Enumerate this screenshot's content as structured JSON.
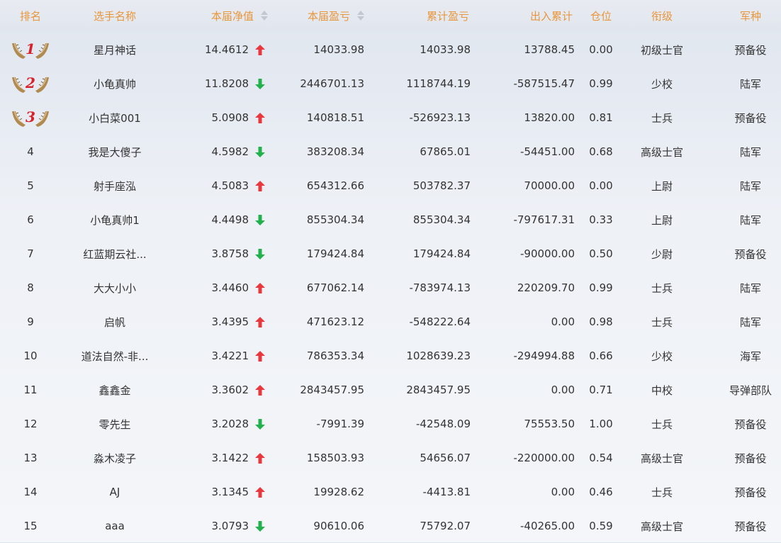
{
  "header": {
    "rank": "排名",
    "name": "选手名称",
    "nav": "本届净值",
    "pnl": "本届盈亏",
    "cumulative": "累计盈亏",
    "flow": "出入累计",
    "position": "仓位",
    "title": "衔级",
    "arm": "军种"
  },
  "colors": {
    "header_text": "#e8963c",
    "up_arrow": "#e8383d",
    "down_arrow": "#23b14d",
    "medal_number": "#d8222a",
    "wing": "#b08a50"
  },
  "rows": [
    {
      "rank": "1",
      "medal": true,
      "name": "星月神话",
      "nav": "14.4612",
      "trend": "up",
      "pnl": "14033.98",
      "cumulative": "14033.98",
      "flow": "13788.45",
      "position": "0.00",
      "title": "初级士官",
      "arm": "预备役"
    },
    {
      "rank": "2",
      "medal": true,
      "name": "小龟真帅",
      "nav": "11.8208",
      "trend": "down",
      "pnl": "2446701.13",
      "cumulative": "1118744.19",
      "flow": "-587515.47",
      "position": "0.99",
      "title": "少校",
      "arm": "陆军"
    },
    {
      "rank": "3",
      "medal": true,
      "name": "小白菜001",
      "nav": "5.0908",
      "trend": "up",
      "pnl": "140818.51",
      "cumulative": "-526923.13",
      "flow": "13820.00",
      "position": "0.81",
      "title": "士兵",
      "arm": "预备役"
    },
    {
      "rank": "4",
      "medal": false,
      "name": "我是大傻子",
      "nav": "4.5982",
      "trend": "down",
      "pnl": "383208.34",
      "cumulative": "67865.01",
      "flow": "-54451.00",
      "position": "0.68",
      "title": "高级士官",
      "arm": "陆军"
    },
    {
      "rank": "5",
      "medal": false,
      "name": "射手座泓",
      "nav": "4.5083",
      "trend": "up",
      "pnl": "654312.66",
      "cumulative": "503782.37",
      "flow": "70000.00",
      "position": "0.00",
      "title": "上尉",
      "arm": "陆军"
    },
    {
      "rank": "6",
      "medal": false,
      "name": "小龟真帅1",
      "nav": "4.4498",
      "trend": "down",
      "pnl": "855304.34",
      "cumulative": "855304.34",
      "flow": "-797617.31",
      "position": "0.33",
      "title": "上尉",
      "arm": "陆军"
    },
    {
      "rank": "7",
      "medal": false,
      "name": "红蓝期云社...",
      "nav": "3.8758",
      "trend": "down",
      "pnl": "179424.84",
      "cumulative": "179424.84",
      "flow": "-90000.00",
      "position": "0.50",
      "title": "少尉",
      "arm": "预备役"
    },
    {
      "rank": "8",
      "medal": false,
      "name": "大大小小",
      "nav": "3.4460",
      "trend": "up",
      "pnl": "677062.14",
      "cumulative": "-783974.13",
      "flow": "220209.70",
      "position": "0.99",
      "title": "士兵",
      "arm": "陆军"
    },
    {
      "rank": "9",
      "medal": false,
      "name": "启帆",
      "nav": "3.4395",
      "trend": "up",
      "pnl": "471623.12",
      "cumulative": "-548222.64",
      "flow": "0.00",
      "position": "0.98",
      "title": "士兵",
      "arm": "陆军"
    },
    {
      "rank": "10",
      "medal": false,
      "name": "道法自然-非...",
      "nav": "3.4221",
      "trend": "up",
      "pnl": "786353.34",
      "cumulative": "1028639.23",
      "flow": "-294994.88",
      "position": "0.66",
      "title": "少校",
      "arm": "海军"
    },
    {
      "rank": "11",
      "medal": false,
      "name": "鑫鑫金",
      "nav": "3.3602",
      "trend": "up",
      "pnl": "2843457.95",
      "cumulative": "2843457.95",
      "flow": "0.00",
      "position": "0.71",
      "title": "中校",
      "arm": "导弹部队"
    },
    {
      "rank": "12",
      "medal": false,
      "name": "零先生",
      "nav": "3.2028",
      "trend": "down",
      "pnl": "-7991.39",
      "cumulative": "-42548.09",
      "flow": "75553.50",
      "position": "1.00",
      "title": "士兵",
      "arm": "预备役"
    },
    {
      "rank": "13",
      "medal": false,
      "name": "淼木凌子",
      "nav": "3.1422",
      "trend": "up",
      "pnl": "158503.93",
      "cumulative": "54656.07",
      "flow": "-220000.00",
      "position": "0.54",
      "title": "高级士官",
      "arm": "预备役"
    },
    {
      "rank": "14",
      "medal": false,
      "name": "AJ",
      "nav": "3.1345",
      "trend": "up",
      "pnl": "19928.62",
      "cumulative": "-4413.81",
      "flow": "0.00",
      "position": "0.46",
      "title": "士兵",
      "arm": "预备役"
    },
    {
      "rank": "15",
      "medal": false,
      "name": "aaa",
      "nav": "3.0793",
      "trend": "down",
      "pnl": "90610.06",
      "cumulative": "75792.07",
      "flow": "-40265.00",
      "position": "0.59",
      "title": "高级士官",
      "arm": "预备役"
    }
  ]
}
